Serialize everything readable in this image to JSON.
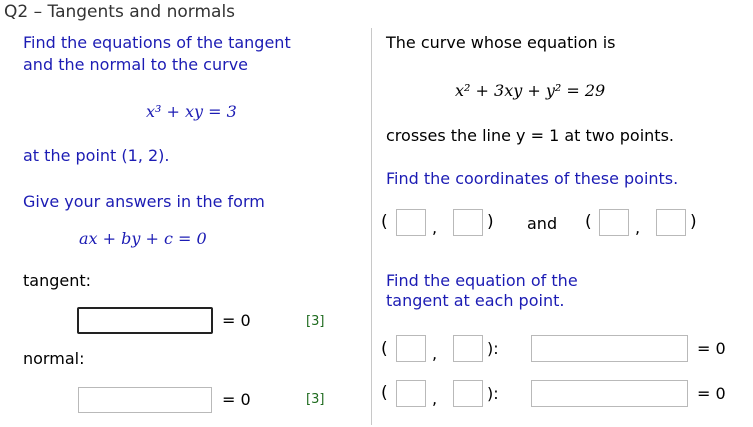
{
  "title": "Q2 – Tangents and normals",
  "left": {
    "instruction_line1": "Find the equations of the tangent",
    "instruction_line2": "and the normal to the curve",
    "curve_eq": "x³ + xy = 3",
    "point": "at the point (1, 2).",
    "form_prompt": "Give your answers in the form",
    "form_eq": "ax + by + c = 0",
    "tangent_label": "tangent:",
    "normal_label": "normal:",
    "equals_zero": "= 0",
    "tangent_marks": "[3]",
    "normal_marks": "[3]",
    "tangent_value": "",
    "normal_value": ""
  },
  "right": {
    "curve_intro": "The curve whose equation is",
    "curve_eq": "x² + 3xy + y² = 29",
    "crosses_text": "crosses the line y = 1 at two points.",
    "find_coords": "Find the coordinates of these points.",
    "and_label": "and",
    "find_tangent_line1": "Find the equation of the",
    "find_tangent_line2": "tangent at each point.",
    "equals_zero": "= 0",
    "comma": ",",
    "colon": "):",
    "open_paren": "(",
    "close_paren": ")"
  },
  "colors": {
    "instruction_blue": "#1c1cb4",
    "marks_green": "#1f6b1f",
    "input_border": "#b9b9b9",
    "active_border": "#222222"
  }
}
